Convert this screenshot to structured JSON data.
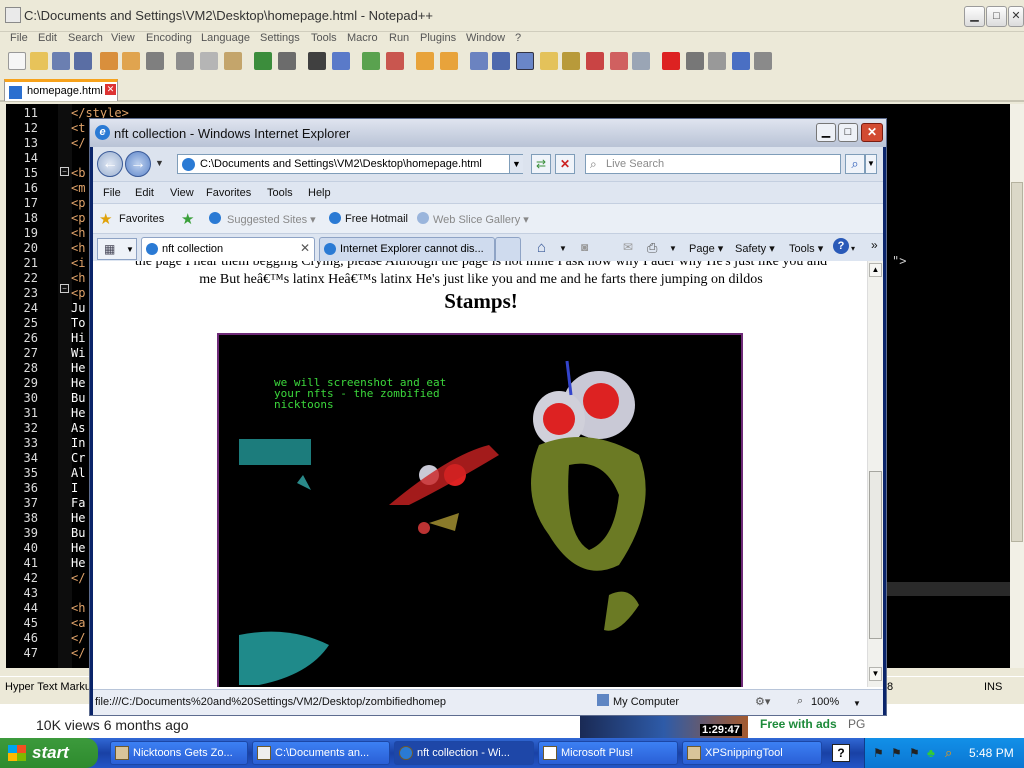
{
  "npp": {
    "title": "C:\\Documents and Settings\\VM2\\Desktop\\homepage.html - Notepad++",
    "menu": [
      "File",
      "Edit",
      "Search",
      "View",
      "Encoding",
      "Language",
      "Settings",
      "Tools",
      "Macro",
      "Run",
      "Plugins",
      "Window",
      "?"
    ],
    "tab_label": "homepage.html",
    "lines": [
      {
        "n": "11",
        "code": "</style>"
      },
      {
        "n": "12",
        "code": "<t"
      },
      {
        "n": "13",
        "code": "</"
      },
      {
        "n": "14",
        "code": ""
      },
      {
        "n": "15",
        "code": "<b"
      },
      {
        "n": "16",
        "code": "<m"
      },
      {
        "n": "17",
        "code": "<p"
      },
      {
        "n": "18",
        "code": "<p"
      },
      {
        "n": "19",
        "code": "<h"
      },
      {
        "n": "20",
        "code": "<h"
      },
      {
        "n": "21",
        "code": "<i"
      },
      {
        "n": "22",
        "code": "<h"
      },
      {
        "n": "23",
        "code": "<p"
      },
      {
        "n": "24",
        "code": "Ju"
      },
      {
        "n": "25",
        "code": "To"
      },
      {
        "n": "26",
        "code": "Hi"
      },
      {
        "n": "27",
        "code": "Wi"
      },
      {
        "n": "28",
        "code": "He"
      },
      {
        "n": "29",
        "code": "He"
      },
      {
        "n": "30",
        "code": "Bu"
      },
      {
        "n": "31",
        "code": "He"
      },
      {
        "n": "32",
        "code": "As"
      },
      {
        "n": "33",
        "code": "In"
      },
      {
        "n": "34",
        "code": "Cr"
      },
      {
        "n": "35",
        "code": "Al"
      },
      {
        "n": "36",
        "code": "I"
      },
      {
        "n": "37",
        "code": "Fa"
      },
      {
        "n": "38",
        "code": "He"
      },
      {
        "n": "39",
        "code": "Bu"
      },
      {
        "n": "40",
        "code": "He"
      },
      {
        "n": "41",
        "code": "He"
      },
      {
        "n": "42",
        "code": "</"
      },
      {
        "n": "43",
        "code": ""
      },
      {
        "n": "44",
        "code": "<h"
      },
      {
        "n": "45",
        "code": "<a"
      },
      {
        "n": "46",
        "code": "</"
      },
      {
        "n": "47",
        "code": "</"
      }
    ],
    "right_fragment": "\">",
    "status_left": "Hyper Text Markup",
    "status_col": "8",
    "status_ins": "INS"
  },
  "below": {
    "views": "10K views  6 months ago",
    "ads": "Free with ads",
    "pg": "PG",
    "thumb_time": "1:29:47"
  },
  "ie": {
    "title": "nft collection - Windows Internet Explorer",
    "address": "C:\\Documents and Settings\\VM2\\Desktop\\homepage.html",
    "search_placeholder": "Live Search",
    "menu": [
      "File",
      "Edit",
      "View",
      "Favorites",
      "Tools",
      "Help"
    ],
    "favorites": "Favorites",
    "suggested": "Suggested Sites ▾",
    "hotmail": "Free Hotmail",
    "slice": "Web Slice Gallery ▾",
    "tab1": "nft collection",
    "tab2": "Internet Explorer cannot dis...",
    "cmd": {
      "page": "Page ▾",
      "safety": "Safety ▾",
      "tools": "Tools ▾",
      "help": "▾"
    },
    "line_cut": "the page I hear them begging Crying, please Although the page is not mine I ask how why I ader why He's just like you and",
    "line2": "me But heâ€™s latinx Heâ€™s latinx He's just like you and me and he farts there jumping on dildos",
    "heading": "Stamps!",
    "image_caption": "we will screenshot and eat\nyour nfts - the zombified\nnicktoons",
    "status_url": "file:///C:/Documents%20and%20Settings/VM2/Desktop/zombifiedhomep",
    "status_zone": "My Computer",
    "status_zoom": "100%"
  },
  "taskbar": {
    "start": "start",
    "tasks": [
      "Nicktoons Gets Zo...",
      "C:\\Documents an...",
      "nft collection - Wi...",
      "Microsoft Plus!",
      "XPSnippingTool"
    ],
    "clock": "5:48 PM"
  },
  "colors": {
    "accent": "#f7a21b",
    "caption": "#3cd83c",
    "taskbar": "#245edb"
  }
}
